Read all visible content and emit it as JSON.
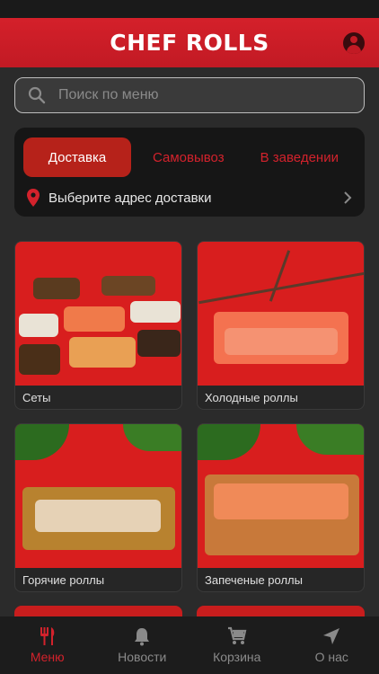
{
  "app": {
    "logo": "CHEF ROLLS"
  },
  "search": {
    "placeholder": "Поиск по меню"
  },
  "delivery": {
    "tabs": [
      "Доставка",
      "Самовывоз",
      "В заведении"
    ],
    "address_label": "Выберите адрес доставки"
  },
  "categories": [
    {
      "label": "Сеты"
    },
    {
      "label": "Холодные роллы"
    },
    {
      "label": "Горячие роллы"
    },
    {
      "label": "Запеченые роллы"
    }
  ],
  "tabbar": {
    "items": [
      {
        "label": "Меню",
        "icon": "fork-knife-icon"
      },
      {
        "label": "Новости",
        "icon": "bell-icon"
      },
      {
        "label": "Корзина",
        "icon": "cart-icon"
      },
      {
        "label": "О нас",
        "icon": "navigation-arrow-icon"
      }
    ]
  },
  "colors": {
    "brand": "#d3222c",
    "background": "#2b2b2b"
  }
}
